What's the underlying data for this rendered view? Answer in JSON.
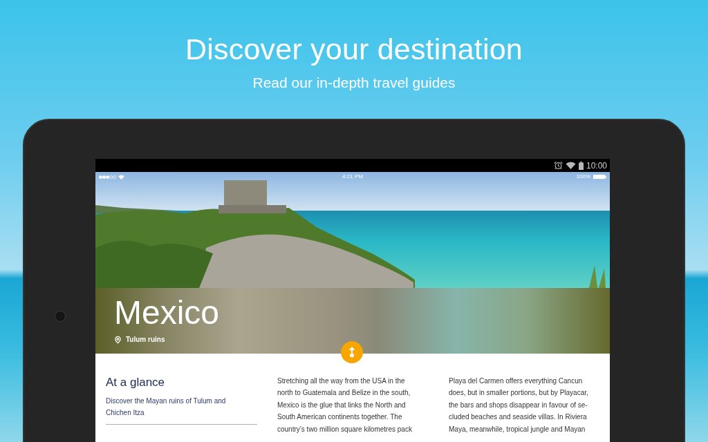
{
  "promo": {
    "title": "Discover your destination",
    "subtitle": "Read our in-depth travel guides"
  },
  "device_status_bar": {
    "time": "10:00"
  },
  "app_status_bar": {
    "time": "4:21 PM",
    "battery": "100%"
  },
  "destination": {
    "name": "Mexico",
    "location": "Tulum ruins"
  },
  "at_a_glance": {
    "heading": "At a glance",
    "summary": "Discover the Mayan ruins of Tulum and Chichen Itza"
  },
  "columns": [
    "Stretching all the way from the USA in the\nnorth to Guatemala and Belize in the south,\nMexico is the glue that links the North and\nSouth American continents together. The\ncountry’s two million square kilometres pack",
    "Playa del Carmen offers everything Cancun\ndoes, but in smaller portions, but by Playacar,\nthe bars and shops disappear in favour of se-\ncluded beaches and seaside villas. In Riviera\nMaya, meanwhile, tropical jungle and Mayan"
  ]
}
